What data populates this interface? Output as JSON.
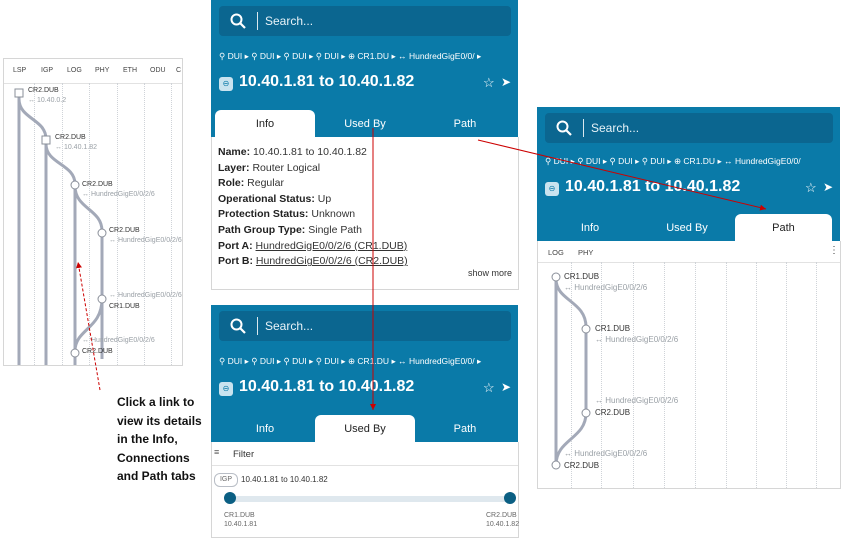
{
  "left_panel": {
    "columns": [
      "LSP",
      "IGP",
      "LOG",
      "PHY",
      "ETH",
      "ODU",
      "C"
    ],
    "nodes": [
      {
        "name": "CR2.DUB",
        "sub": "10.40.0.2"
      },
      {
        "name": "CR2.DUB",
        "sub": "10.40.1.82"
      },
      {
        "name": "CR2.DUB",
        "sub": "HundredGigE0/0/2/6"
      },
      {
        "name": "CR2.DUB",
        "sub": "HundredGigE0/0/2/6"
      },
      {
        "name": "CR1.DUB",
        "sub": "HundredGigE0/0/2/6"
      },
      {
        "name": "CR2.DUB",
        "sub": "HundredGigE0/0/2/6"
      }
    ]
  },
  "callout": {
    "text": "Click a link to view its details in the Info, Connections and Path tabs"
  },
  "search": {
    "placeholder": "Search..."
  },
  "breadcrumb": {
    "items": [
      "DUI",
      "DUI",
      "DUI",
      "DUI",
      "CR1.DU",
      "HundredGigE0/0/"
    ],
    "items_right": [
      "DUI",
      "DUI",
      "DUI",
      "DUI",
      "CR1.DU",
      "HundredGigE0/0/"
    ]
  },
  "link": {
    "title": "10.40.1.81 to 10.40.1.82"
  },
  "tabs": {
    "info": "Info",
    "used_by": "Used By",
    "path": "Path"
  },
  "info": {
    "name_label": "Name:",
    "name": "10.40.1.81 to 10.40.1.82",
    "layer_label": "Layer:",
    "layer": "Router Logical",
    "role_label": "Role:",
    "role": "Regular",
    "op_label": "Operational Status:",
    "op": "Up",
    "prot_label": "Protection Status:",
    "prot": "Unknown",
    "pgt_label": "Path Group Type:",
    "pgt": "Single Path",
    "porta_label": "Port A:",
    "porta": "HundredGigE0/0/2/6 (CR1.DUB)",
    "portb_label": "Port B:",
    "portb": "HundredGigE0/0/2/6 (CR2.DUB)",
    "show_more": "show more"
  },
  "used_by": {
    "filter": "Filter",
    "badge": "IGP",
    "item_title": "10.40.1.81 to 10.40.1.82",
    "left_node": "CR1.DUB",
    "left_ip": "10.40.1.81",
    "right_node": "CR2.DUB",
    "right_ip": "10.40.1.82"
  },
  "path_panel": {
    "cols": [
      "LOG",
      "PHY"
    ],
    "nodes": [
      {
        "name": "CR1.DUB",
        "sub": "HundredGigE0/0/2/6"
      },
      {
        "name": "CR1.DUB",
        "sub": "HundredGigE0/0/2/6"
      },
      {
        "name": "CR2.DUB",
        "sub": "HundredGigE0/0/2/6"
      },
      {
        "name": "CR2.DUB",
        "sub": "HundredGigE0/0/2/6"
      }
    ]
  },
  "colors": {
    "primary": "#0a7aa8",
    "search_bg": "#0b6690",
    "arrow": "#cc0000",
    "path_line": "#a3a9b8"
  }
}
